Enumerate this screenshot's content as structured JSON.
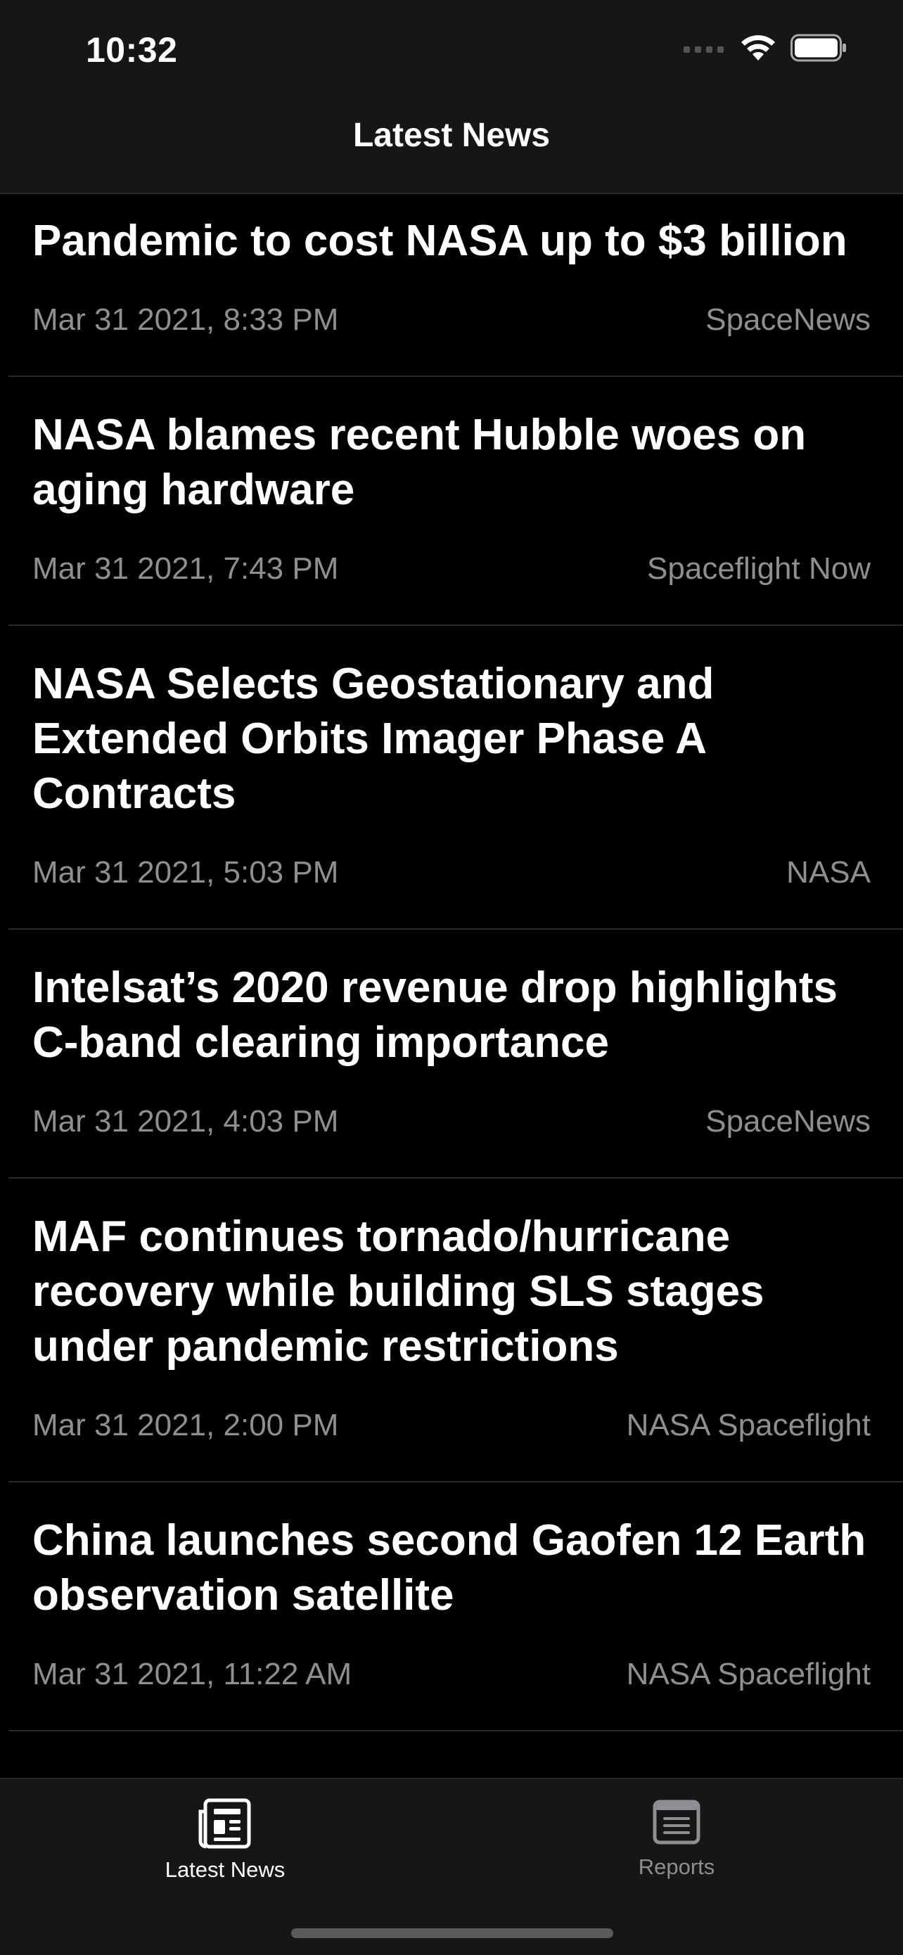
{
  "status_bar": {
    "time": "10:32",
    "icons": [
      "cellular-icon",
      "wifi-icon",
      "battery-icon"
    ]
  },
  "nav": {
    "title": "Latest News"
  },
  "articles": [
    {
      "title": "Pandemic to cost NASA up to $3 billion",
      "date": "Mar 31 2021, 8:33 PM",
      "source": "SpaceNews"
    },
    {
      "title": "NASA blames recent Hubble woes on aging hardware",
      "date": "Mar 31 2021, 7:43 PM",
      "source": "Spaceflight Now"
    },
    {
      "title": "NASA Selects Geostationary and Extended Orbits Imager Phase A Contracts",
      "date": "Mar 31 2021, 5:03 PM",
      "source": "NASA"
    },
    {
      "title": "Intelsat’s 2020 revenue drop highlights C-band clearing importance",
      "date": "Mar 31 2021, 4:03 PM",
      "source": "SpaceNews"
    },
    {
      "title": "MAF continues tornado/hurricane recovery while building SLS stages under pandemic restrictions",
      "date": "Mar 31 2021, 2:00 PM",
      "source": "NASA Spaceflight"
    },
    {
      "title": "China launches second Gaofen 12 Earth observation satellite",
      "date": "Mar 31 2021, 11:22 AM",
      "source": "NASA Spaceflight"
    }
  ],
  "tab_bar": {
    "tabs": [
      {
        "label": "Latest News",
        "icon": "newspaper-icon",
        "selected": true
      },
      {
        "label": "Reports",
        "icon": "report-icon",
        "selected": false
      }
    ]
  },
  "colors": {
    "background": "#000000",
    "bar_background": "#161616",
    "text_primary": "#ffffff",
    "text_secondary": "#8e8e93",
    "separator": "#2a2a2a"
  }
}
